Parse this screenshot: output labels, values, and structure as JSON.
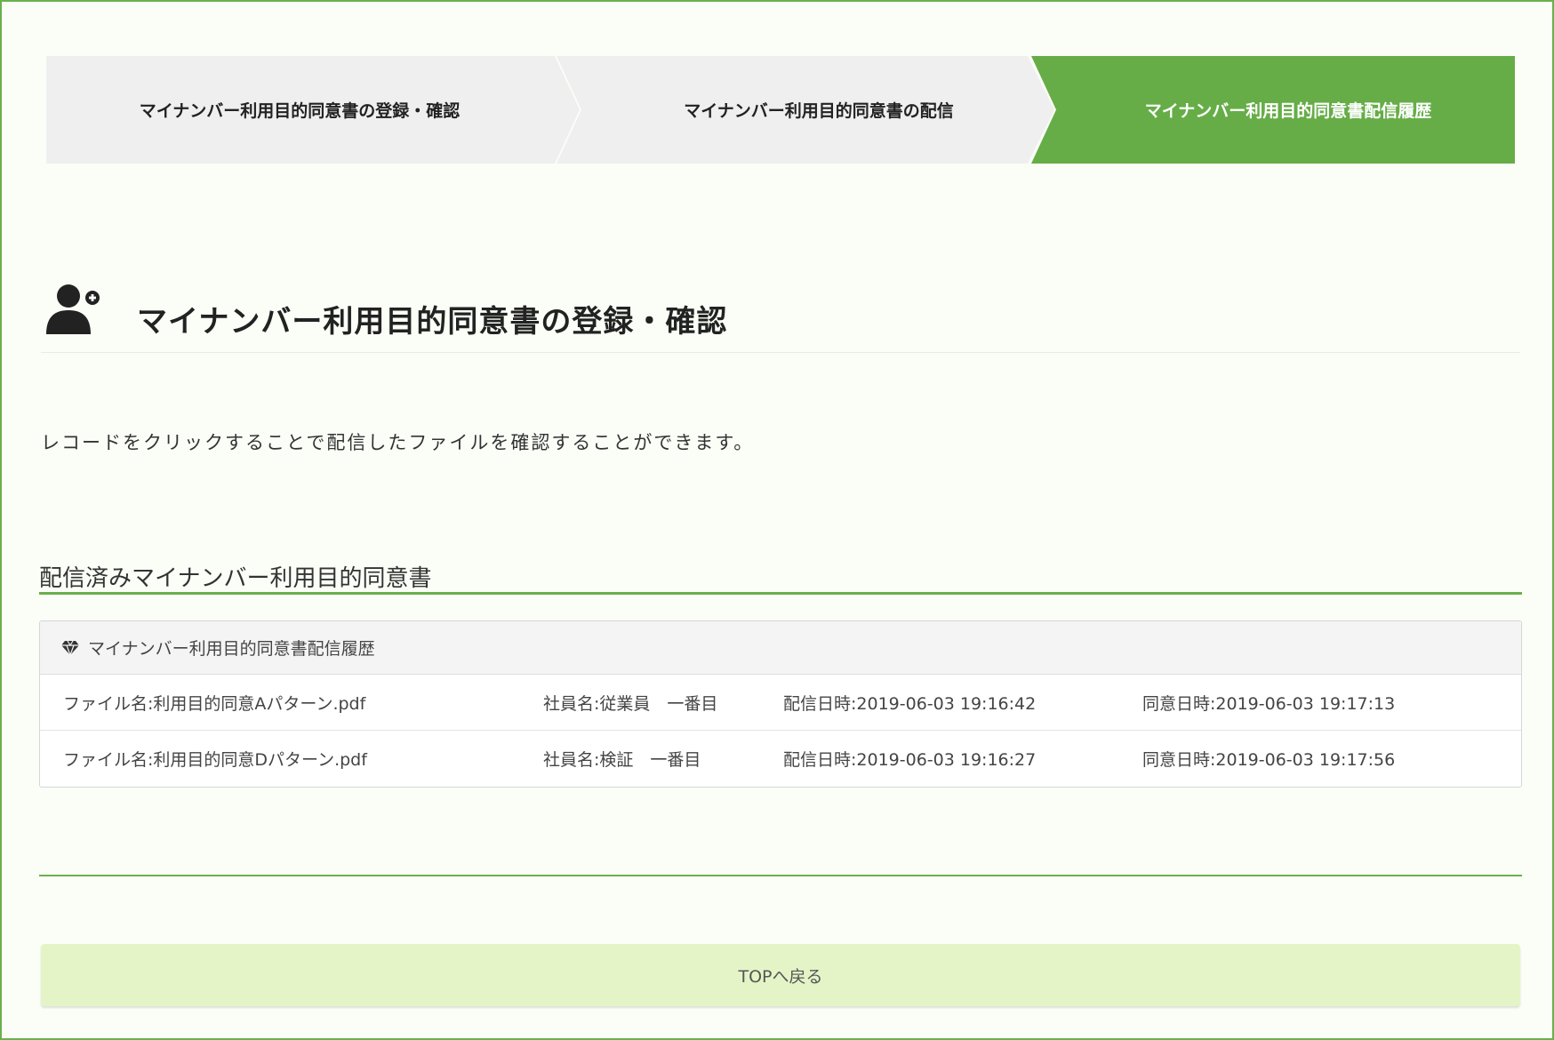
{
  "steps": [
    {
      "label": "マイナンバー利用目的同意書の登録・確認",
      "active": false
    },
    {
      "label": "マイナンバー利用目的同意書の配信",
      "active": false
    },
    {
      "label": "マイナンバー利用目的同意書配信履歴",
      "active": true
    }
  ],
  "header": {
    "icon": "user-plus-icon",
    "title": "マイナンバー利用目的同意書の登録・確認"
  },
  "description": "レコードをクリックすることで配信したファイルを確認することができます。",
  "section": {
    "title": "配信済みマイナンバー利用目的同意書"
  },
  "panel": {
    "icon": "gem-icon",
    "title": "マイナンバー利用目的同意書配信履歴",
    "rows": [
      {
        "file": "ファイル名:利用目的同意Aパターン.pdf",
        "employee": "社員名:従業員　一番目",
        "delivered": "配信日時:2019-06-03 19:16:42",
        "agreed": "同意日時:2019-06-03 19:17:13"
      },
      {
        "file": "ファイル名:利用目的同意Dパターン.pdf",
        "employee": "社員名:検証　一番目",
        "delivered": "配信日時:2019-06-03 19:16:27",
        "agreed": "同意日時:2019-06-03 19:17:56"
      }
    ]
  },
  "buttons": {
    "top": "TOPへ戻る"
  },
  "colors": {
    "accent": "#66ad47",
    "step_inactive": "#efefef",
    "button_bg": "#e4f4c7",
    "page_bg": "#fbfef7"
  }
}
